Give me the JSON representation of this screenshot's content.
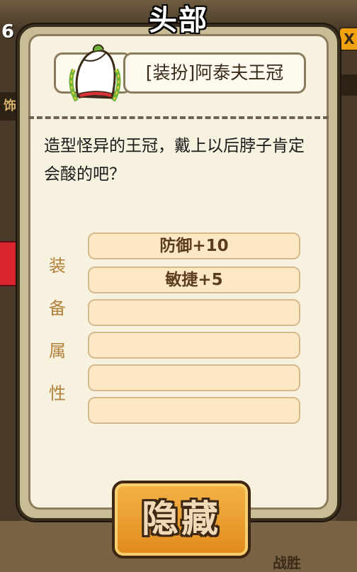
{
  "background": {
    "level_number": "6",
    "side_label": "饰",
    "close_label": "X",
    "bottom_text": "战胜"
  },
  "panel": {
    "title": "头部",
    "item": {
      "name": "[装扮]阿泰夫王冠",
      "icon": "crown-hat-icon"
    },
    "description": "造型怪异的王冠，戴上以后脖子肯定会酸的吧？",
    "attributes_label": [
      "装",
      "备",
      "属",
      "性"
    ],
    "attributes": [
      "防御+10",
      "敏捷+5",
      "",
      "",
      "",
      ""
    ]
  },
  "hide_button": {
    "label": "隐藏"
  },
  "colors": {
    "panel_bg": "#f7f1df",
    "panel_frame": "#c9bd96",
    "attr_row_bg": "#fde7c5",
    "attr_label": "#b3823d",
    "button": "#e18a1c"
  }
}
